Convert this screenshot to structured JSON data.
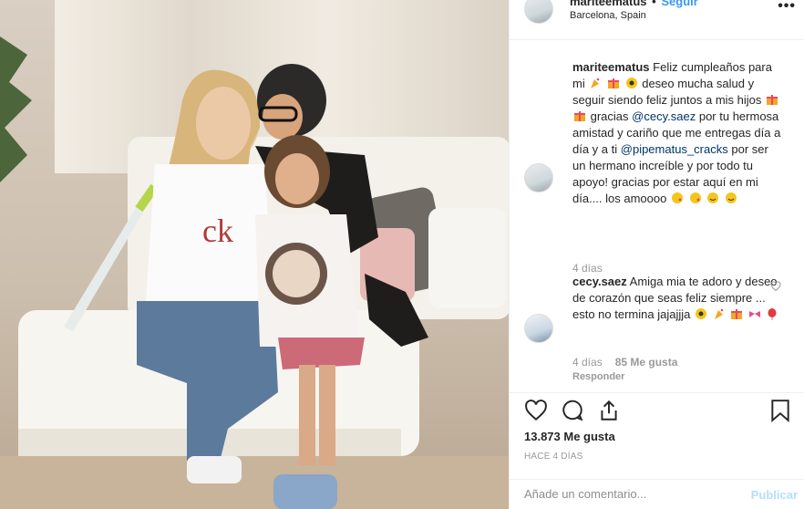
{
  "post_header": {
    "username": "mariteematus",
    "separator": "•",
    "follow_label": "Seguir",
    "location": "Barcelona, Spain",
    "more_glyph": "•••"
  },
  "caption": {
    "username": "mariteematus",
    "text_1": "Feliz cumpleaños para mi",
    "text_2": "deseo mucha salud y seguir siendo feliz juntos a mis hijos",
    "text_3": "gracias",
    "mention_1": "@cecy.saez",
    "text_4": "por tu hermosa amistad y cariño que me entregas día a día y a ti",
    "mention_2": "@pipematus_cracks",
    "text_5": "por ser un hermano increíble y por todo tu apoyo! gracias por estar aquí en mi día.... los amoooo",
    "time": "4 días"
  },
  "comment": {
    "username": "cecy.saez",
    "text": "Amiga mia te adoro y deseo de corazón que seas feliz siempre ... esto no termina jajajjja",
    "time": "4 días",
    "likes": "85 Me gusta",
    "reply_label": "Responder"
  },
  "actions": {
    "likes": "13.873 Me gusta",
    "timestamp": "HACE 4 DÍAS"
  },
  "add_comment": {
    "placeholder": "Añade un comentario...",
    "post_label": "Publicar"
  },
  "colors": {
    "link": "#003569",
    "follow": "#3897f0",
    "post_disabled": "#b2dffc",
    "muted": "#999999"
  },
  "icons": [
    "more-icon",
    "heart-icon",
    "comment-icon",
    "share-icon",
    "bookmark-icon",
    "small-heart-icon"
  ]
}
